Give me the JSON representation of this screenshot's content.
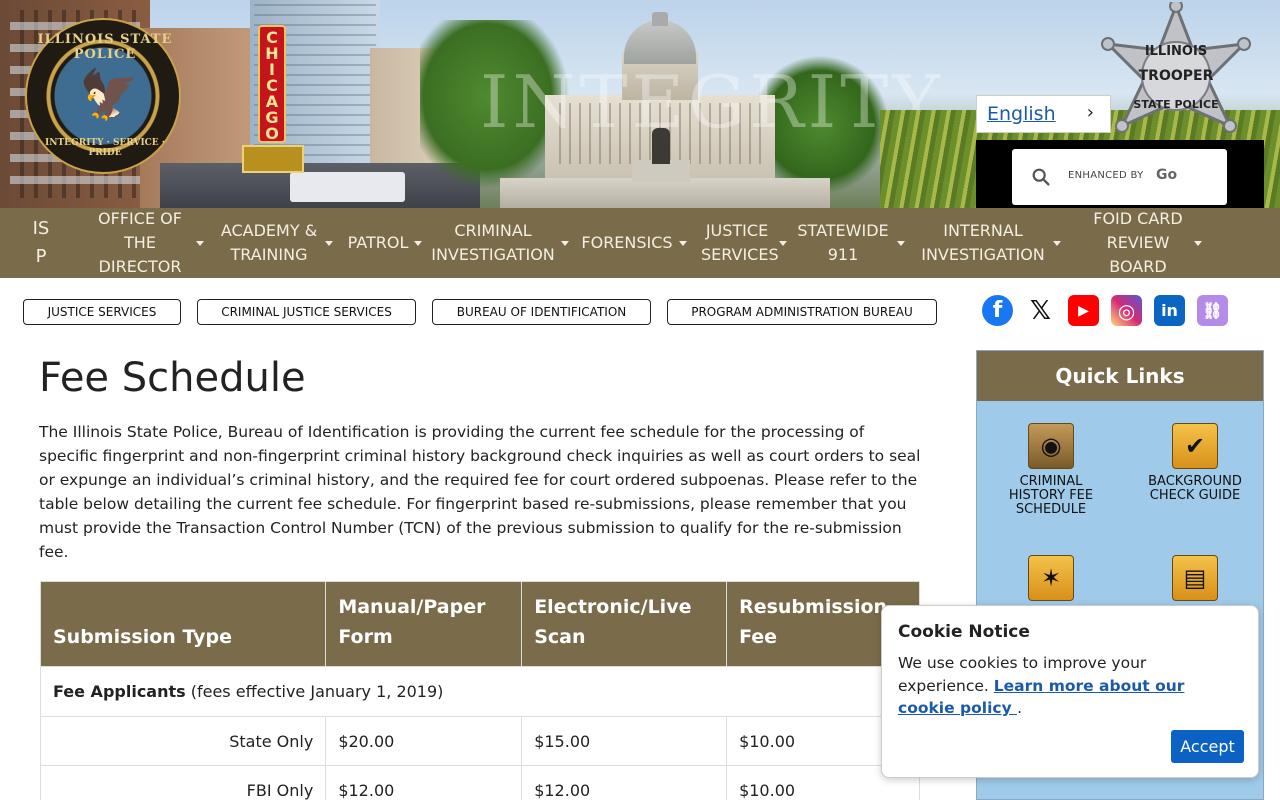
{
  "banner": {
    "seal_top": "ILLINOIS STATE POLICE",
    "seal_bottom": "INTEGRITY · SERVICE · PRIDE",
    "chicago_sign": "CHICAGO",
    "watermark": "INTEGRITY",
    "star_line1": "ILLINOIS",
    "star_line2": "TROOPER",
    "star_line3": "STATE POLICE"
  },
  "language": {
    "label": "English"
  },
  "search": {
    "placeholder": "ENHANCED BY",
    "brand": "Go"
  },
  "nav": {
    "isp": "IS\nP",
    "items": [
      {
        "label": "OFFICE OF THE DIRECTOR"
      },
      {
        "label": "ACADEMY & TRAINING"
      },
      {
        "label": "PATROL"
      },
      {
        "label": "CRIMINAL INVESTIGATION"
      },
      {
        "label": "FORENSICS"
      },
      {
        "label": "JUSTICE SERVICES"
      },
      {
        "label": "STATEWIDE 911"
      },
      {
        "label": "INTERNAL INVESTIGATION"
      },
      {
        "label": "FOID CARD REVIEW BOARD"
      }
    ]
  },
  "breadcrumbs": [
    "JUSTICE SERVICES",
    "CRIMINAL JUSTICE SERVICES",
    "BUREAU OF IDENTIFICATION",
    "PROGRAM ADMINISTRATION BUREAU"
  ],
  "social": [
    {
      "name": "facebook",
      "glyph": "f",
      "color": "#1877f2"
    },
    {
      "name": "x",
      "glyph": "𝕏",
      "color": "#ffffff"
    },
    {
      "name": "youtube",
      "glyph": "▶",
      "color": "#ff0000"
    },
    {
      "name": "instagram",
      "glyph": "◎",
      "color": "#d62976"
    },
    {
      "name": "linkedin",
      "glyph": "in",
      "color": "#0a66c2"
    },
    {
      "name": "link",
      "glyph": "⛓",
      "color": "#b48be8"
    }
  ],
  "page": {
    "title": "Fee Schedule",
    "intro": "The Illinois State Police, Bureau of Identification is providing the current fee schedule for the processing of specific fingerprint and non-fingerprint criminal history background check inquiries as well as court orders to seal or expunge an individual’s criminal history, and the required fee for court ordered subpoenas. Please refer to the table below detailing the current fee schedule. For fingerprint based re-submissions, please remember that you must provide the Transaction Control Number (TCN) of the previous submission to qualify for the re-submission fee."
  },
  "table": {
    "headers": [
      "Submission Type",
      "Manual/Paper Form",
      "Electronic/Live Scan",
      "Resubmission Fee"
    ],
    "group_title": "Fee Applicants",
    "group_note": " (fees effective January 1, 2019)",
    "rows": [
      {
        "type": "State Only",
        "manual": "$20.00",
        "electronic": "$15.00",
        "resub": "$10.00"
      },
      {
        "type": "FBI Only",
        "manual": "$12.00",
        "electronic": "$12.00",
        "resub": "$10.00"
      }
    ]
  },
  "quick_links": {
    "title": "Quick Links",
    "items": [
      {
        "label": "CRIMINAL HISTORY FEE SCHEDULE",
        "icon": "fingerprint-icon"
      },
      {
        "label": "BACKGROUND CHECK GUIDE",
        "icon": "magnifier-check-icon"
      },
      {
        "label": "",
        "icon": "cannabis-leaf-icon"
      },
      {
        "label": "",
        "icon": "document-gavel-icon"
      }
    ]
  },
  "cookie": {
    "title": "Cookie Notice",
    "text": "We use cookies to improve your experience. ",
    "link": "Learn more about our cookie policy ",
    "suffix": ".",
    "accept": "Accept"
  }
}
